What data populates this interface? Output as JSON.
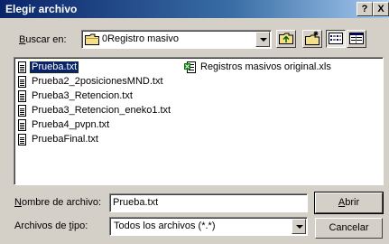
{
  "window": {
    "title": "Elegir archivo",
    "help_button": "?",
    "close_button": "X"
  },
  "lookin": {
    "label_pre": "",
    "label_u": "B",
    "label_post": "uscar en:",
    "value": "0Registro masivo"
  },
  "files": [
    {
      "name": "Prueba.txt",
      "type": "text",
      "selected": true
    },
    {
      "name": "Prueba2_2posicionesMND.txt",
      "type": "text"
    },
    {
      "name": "Prueba3_Retencion.txt",
      "type": "text"
    },
    {
      "name": "Prueba3_Retencion_eneko1.txt",
      "type": "text"
    },
    {
      "name": "Prueba4_pvpn.txt",
      "type": "text"
    },
    {
      "name": "PruebaFinal.txt",
      "type": "text"
    },
    {
      "name": "Registros masivos original.xls",
      "type": "excel"
    }
  ],
  "filename": {
    "label_u": "N",
    "label_post": "ombre de archivo:",
    "value": "Prueba.txt"
  },
  "filetype": {
    "label_pre": "Archivos de ",
    "label_u": "t",
    "label_post": "ipo:",
    "value": "Todos los archivos (*.*)"
  },
  "buttons": {
    "open_u": "A",
    "open_post": "brir",
    "cancel": "Cancelar"
  }
}
